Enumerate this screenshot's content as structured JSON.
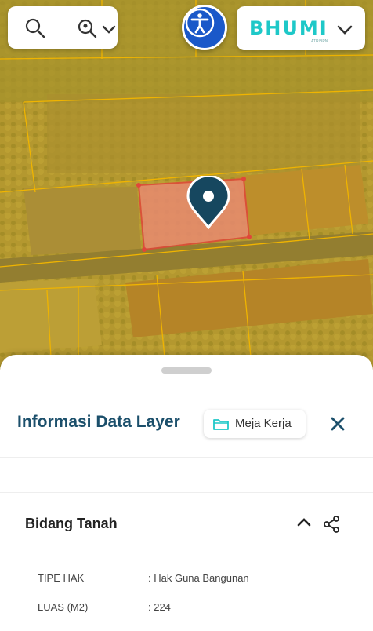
{
  "brand": {
    "name": "BHUMI",
    "sub": "ATR/BPN"
  },
  "panel": {
    "title": "Informasi Data Layer",
    "workspace_label": "Meja Kerja",
    "section_title": "Bidang Tanah",
    "rows": [
      {
        "label": "TIPE HAK",
        "value": ": Hak Guna Bangunan"
      },
      {
        "label": "LUAS (M2)",
        "value": ": 224"
      }
    ]
  },
  "colors": {
    "accent_blue": "#1a58c9",
    "brand_teal": "#1ec8c8",
    "title_color": "#1b4f6b",
    "pin": "#16475f"
  },
  "icons": [
    "search-icon",
    "location-search-icon",
    "chevron-down-icon",
    "accessibility-icon",
    "map-pin-icon",
    "folder-icon",
    "close-icon",
    "chevron-up-icon",
    "share-icon"
  ]
}
